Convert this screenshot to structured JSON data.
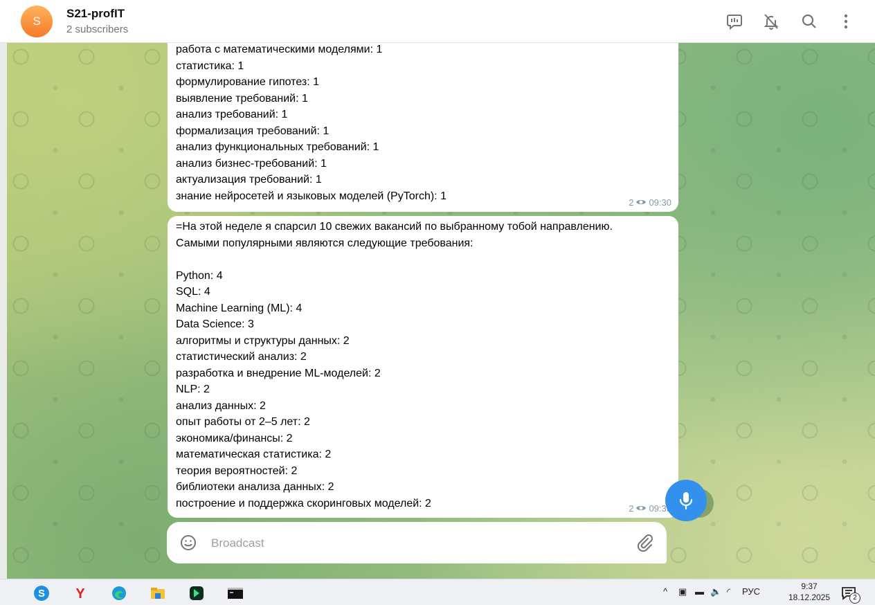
{
  "header": {
    "avatar_letter": "S",
    "title": "S21-profIT",
    "subtitle": "2 subscribers",
    "icons": [
      "poll-icon",
      "bell-off-icon",
      "search-icon",
      "more-vertical-icon"
    ]
  },
  "messages": [
    {
      "lines": [
        "работа с математическими моделями: 1",
        "статистика: 1",
        "формулирование гипотез: 1",
        "выявление требований: 1",
        "анализ требований: 1",
        "формализация требований: 1",
        "анализ функциональных требований: 1",
        "анализ бизнес-требований: 1",
        "актуализация требований: 1",
        "знание нейросетей и языковых моделей (PyTorch): 1"
      ],
      "views": "2",
      "time": "09:30"
    },
    {
      "lines": [
        "=На этой неделе я спарсил 10 свежих вакансий по выбранному тобой направлению.",
        "Самыми популярными являются следующие требования:",
        "",
        "Python: 4",
        "SQL: 4",
        "Machine Learning (ML): 4",
        "Data Science: 3",
        "алгоритмы и структуры данных: 2",
        "статистический анализ: 2",
        "разработка и внедрение ML-моделей: 2",
        "NLP: 2",
        "анализ данных: 2",
        "опыт работы от 2–5 лет: 2",
        "экономика/финансы: 2",
        "математическая статистика: 2",
        "теория вероятностей: 2",
        "библиотеки анализа данных: 2",
        "построение и поддержка скоринговых моделей: 2"
      ],
      "views": "2",
      "time": "09:35"
    }
  ],
  "composer": {
    "placeholder": "Broadcast"
  },
  "taskbar": {
    "apps": [
      "skype-icon",
      "yandex-browser-icon",
      "edge-icon",
      "file-explorer-icon",
      "app-icon",
      "terminal-icon"
    ],
    "language": "РУС",
    "time": "9:37",
    "date": "18.12.2025",
    "notification_count": "2"
  },
  "colors": {
    "accent": "#3390ec",
    "avatar": "#f57a28",
    "meta_text": "#8a9aa5"
  }
}
